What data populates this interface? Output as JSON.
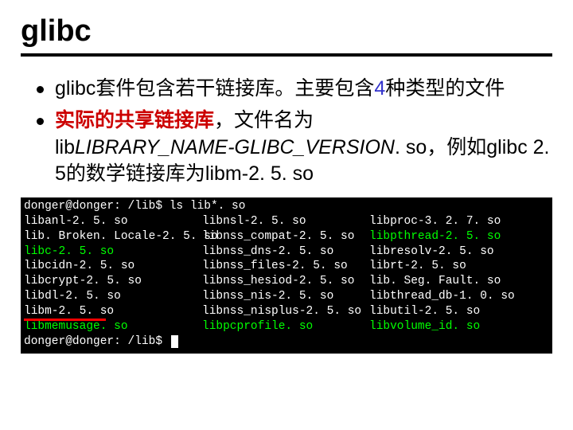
{
  "title": "glibc",
  "bullets": {
    "b1_pre": "glibc套件包含若干链接库。主要包含",
    "b1_four": "4",
    "b1_post": "种类型的文件",
    "b2_lead": "实际的共享链接库",
    "b2_tail1": "，文件名为",
    "b2_line2a": "lib",
    "b2_line2b": "LIBRARY_NAME-GLIBC_VERSION",
    "b2_line2c": ". so，例如glibc 2. 5的数学链接库为libm-2. 5. so"
  },
  "term": {
    "prompt1": "donger@donger: /lib$ ",
    "cmd": "ls lib*. so",
    "col1": {
      "l1": "libanl-2. 5. so",
      "l2": "lib. Broken. Locale-2. 5. so",
      "l3": "libc-2. 5. so",
      "l4": "libcidn-2. 5. so",
      "l5": "libcrypt-2. 5. so",
      "l6": "libdl-2. 5. so",
      "l7": "libm-2. 5. so",
      "l8": "libmemusage. so"
    },
    "col2": {
      "l1": "libnsl-2. 5. so",
      "l2": "libnss_compat-2. 5. so",
      "l3": "libnss_dns-2. 5. so",
      "l4": "libnss_files-2. 5. so",
      "l5": "libnss_hesiod-2. 5. so",
      "l6": "libnss_nis-2. 5. so",
      "l7": "libnss_nisplus-2. 5. so",
      "l8": "libpcprofile. so"
    },
    "col3": {
      "l1": "libproc-3. 2. 7. so",
      "l2": "libpthread-2. 5. so",
      "l3": "libresolv-2. 5. so",
      "l4": "librt-2. 5. so",
      "l5": "lib. Seg. Fault. so",
      "l6": "libthread_db-1. 0. so",
      "l7": "libutil-2. 5. so",
      "l8": "libvolume_id. so"
    },
    "prompt2": "donger@donger: /lib$ "
  }
}
